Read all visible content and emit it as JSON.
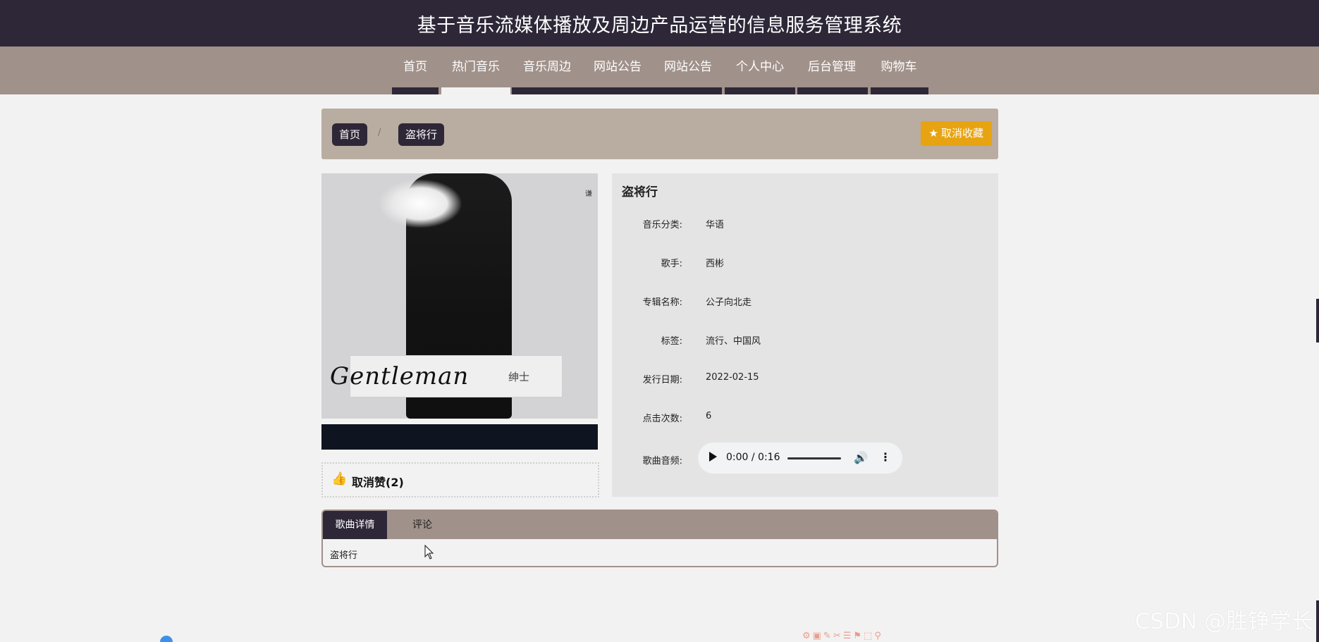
{
  "header": {
    "title": "基于音乐流媒体播放及周边产品运营的信息服务管理系统"
  },
  "nav": {
    "items": [
      {
        "label": "首页"
      },
      {
        "label": "热门音乐"
      },
      {
        "label": "音乐周边"
      },
      {
        "label": "网站公告"
      },
      {
        "label": "网站公告"
      },
      {
        "label": "个人中心"
      },
      {
        "label": "后台管理"
      },
      {
        "label": "购物车"
      }
    ],
    "active": "热门音乐"
  },
  "breadcrumb": {
    "home": "首页",
    "separator": "/",
    "current": "盗将行"
  },
  "favorite_button": {
    "label": "取消收藏",
    "icon": "star-icon"
  },
  "song": {
    "title": "盗将行",
    "cover_signature": "Gentleman",
    "cover_text": "绅士",
    "cover_corner_text": "谦",
    "fields": [
      {
        "label": "音乐分类:",
        "value": "华语"
      },
      {
        "label": "歌手:",
        "value": "西彬"
      },
      {
        "label": "专辑名称:",
        "value": "公子向北走"
      },
      {
        "label": "标签:",
        "value": "流行、中国风"
      },
      {
        "label": "发行日期:",
        "value": "2022-02-15"
      },
      {
        "label": "点击次数:",
        "value": "6"
      }
    ],
    "audio_label": "歌曲音频:",
    "audio_time": "0:00 / 0:16"
  },
  "like": {
    "label": "取消赞(2)",
    "icon": "thumbs-up-icon"
  },
  "tabs": {
    "items": [
      {
        "label": "歌曲详情"
      },
      {
        "label": "评论"
      }
    ],
    "active": "歌曲详情",
    "content": "盗将行"
  },
  "watermark": {
    "text": "CSDN @胜铮学长"
  },
  "colors": {
    "header_bg": "#2e2738",
    "nav_bg": "#a0918a",
    "breadcrumb_bg": "#b9ada1",
    "accent": "#e7a311",
    "like_icon": "#cc1b1b"
  }
}
